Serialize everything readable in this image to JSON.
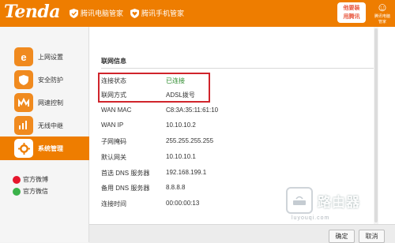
{
  "header": {
    "logo": "Tenda",
    "link1": "腾讯电脑管家",
    "link2": "腾讯手机管家",
    "promo_line1": "他要装",
    "promo_line2": "用腾讯",
    "sublogo_mark": "☺",
    "sublogo_text": "腾讯电脑管家"
  },
  "sidebar": {
    "items": [
      {
        "label": "上网设置",
        "icon": "e-letter-icon"
      },
      {
        "label": "安全防护",
        "icon": "shield-icon"
      },
      {
        "label": "网速控制",
        "icon": "speed-bars-icon"
      },
      {
        "label": "无线中继",
        "icon": "relay-icon"
      },
      {
        "label": "系统管理",
        "icon": "gear-icon"
      }
    ],
    "weibo": "官方微博",
    "wechat": "官方微信"
  },
  "main": {
    "title": "联网信息",
    "rows": [
      {
        "label": "连接状态",
        "value": "已连接"
      },
      {
        "label": "联网方式",
        "value": "ADSL拨号"
      },
      {
        "label": "WAN MAC",
        "value": "C8:3A:35:11:61:10"
      },
      {
        "label": "WAN IP",
        "value": "10.10.10.2"
      },
      {
        "label": "子网掩码",
        "value": "255.255.255.255"
      },
      {
        "label": "默认网关",
        "value": "10.10.10.1"
      },
      {
        "label": "首选 DNS 服务器",
        "value": "192.168.199.1"
      },
      {
        "label": "备用 DNS 服务器",
        "value": "8.8.8.8"
      },
      {
        "label": "连接时间",
        "value": "00:00:00:13"
      }
    ],
    "ok_label": "确定",
    "cancel_label": "取消"
  },
  "watermark": {
    "text": "路由器",
    "url": "luyouqi.com"
  },
  "colors": {
    "brand": "#ee7d00",
    "status_ok": "#2e8b2e",
    "highlight": "#d0242b"
  }
}
